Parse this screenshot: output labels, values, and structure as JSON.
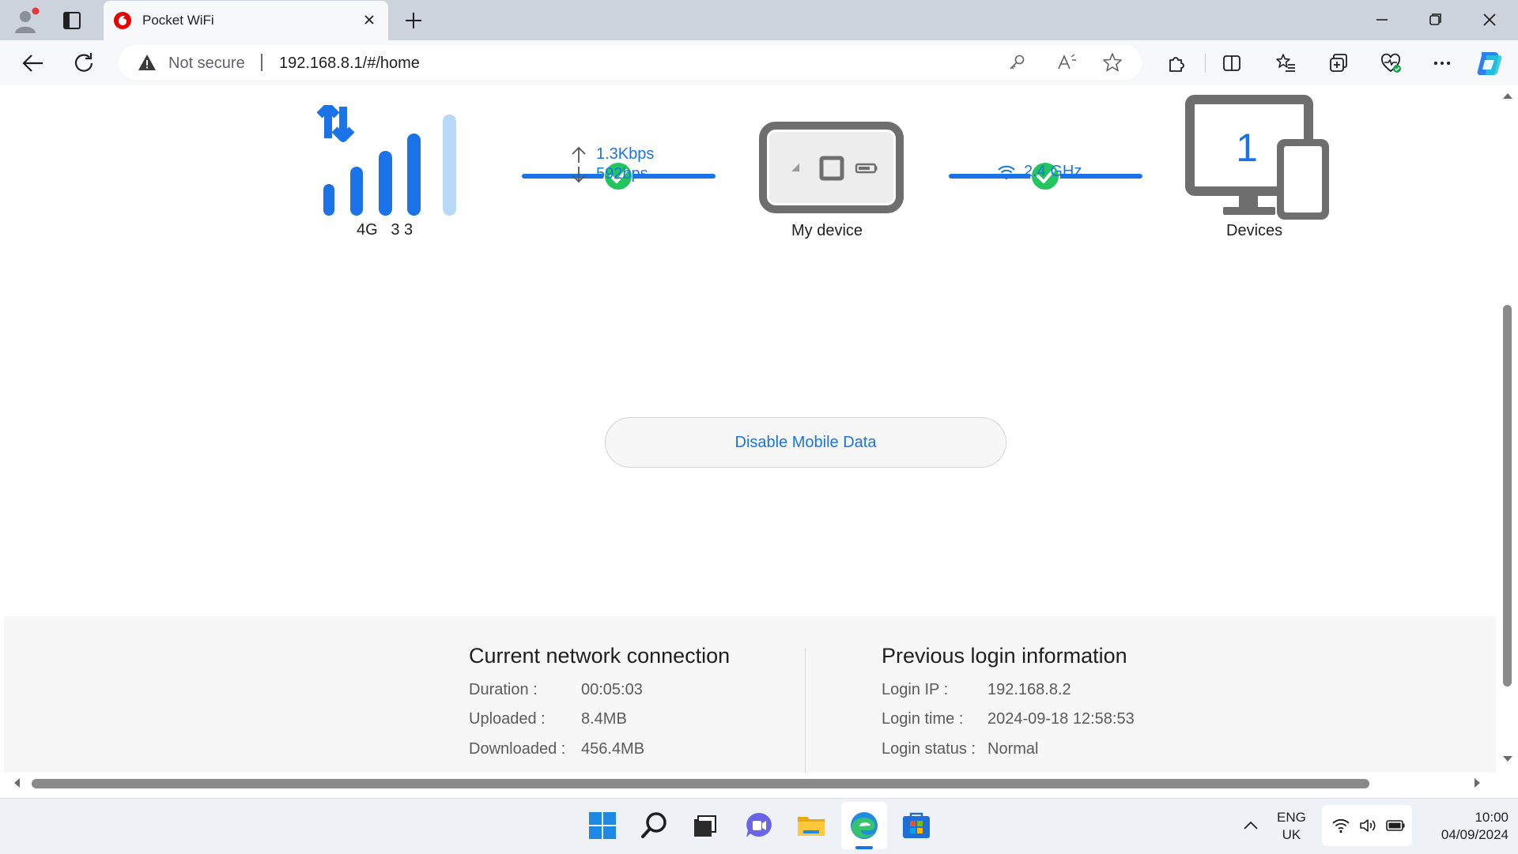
{
  "browser": {
    "tab_title": "Pocket WiFi",
    "security_label": "Not secure",
    "url": "192.168.8.1/#/home"
  },
  "status": {
    "network_type": "4G",
    "signal_a": "3",
    "signal_b": "3",
    "upload_speed": "1.3Kbps",
    "download_speed": "592bps",
    "device_label": "My device",
    "wifi_band": "2.4 GHz",
    "devices_count": "1",
    "devices_label": "Devices",
    "connection_ok": true
  },
  "actions": {
    "disable_data_label": "Disable Mobile Data"
  },
  "current_connection": {
    "title": "Current network connection",
    "rows": [
      {
        "label": "Duration :",
        "value": "00:05:03"
      },
      {
        "label": "Uploaded :",
        "value": "8.4MB"
      },
      {
        "label": "Downloaded :",
        "value": "456.4MB"
      }
    ]
  },
  "previous_login": {
    "title": "Previous login information",
    "rows": [
      {
        "label": "Login IP :",
        "value": "192.168.8.2"
      },
      {
        "label": "Login time :",
        "value": "2024-09-18 12:58:53"
      },
      {
        "label": "Login status :",
        "value": "Normal"
      }
    ]
  },
  "taskbar": {
    "language_line1": "ENG",
    "language_line2": "UK",
    "time": "10:00",
    "date": "04/09/2024",
    "apps": [
      "start-icon",
      "search-icon",
      "task-view-icon",
      "teams-chat-icon",
      "file-explorer-icon",
      "edge-icon",
      "store-icon"
    ]
  },
  "colors": {
    "accent": "#1a73e8",
    "success": "#22c55e",
    "signal_dim": "#b8d8f8",
    "device_gray": "#6e6e6e"
  }
}
